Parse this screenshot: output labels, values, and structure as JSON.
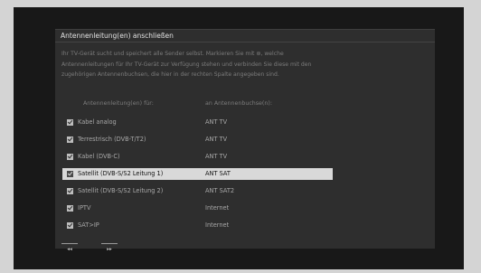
{
  "dialog": {
    "title": "Antennenleitung(en) anschließen",
    "description": [
      "Ihr TV-Gerät sucht und speichert alle Sender selbst. Markieren Sie mit ⊛, welche",
      "Antennenleitungen für Ihr TV-Gerät zur Verfügung stehen und verbinden Sie diese mit den",
      "zugehörigen Antennenbuchsen, die hier in der rechten Spalte angegeben sind."
    ]
  },
  "table": {
    "header_left": "Antennenleitung(en) für:",
    "header_right": "an Antennenbuchse(n):",
    "rows": [
      {
        "label": "Kabel analog",
        "value": "ANT TV",
        "checked": true,
        "selected": false
      },
      {
        "label": "Terrestrisch (DVB-T/T2)",
        "value": "ANT TV",
        "checked": true,
        "selected": false
      },
      {
        "label": "Kabel (DVB-C)",
        "value": "ANT TV",
        "checked": true,
        "selected": false
      },
      {
        "label": "Satellit (DVB-S/S2 Leitung 1)",
        "value": "ANT SAT",
        "checked": true,
        "selected": true
      },
      {
        "label": "Satellit (DVB-S/S2 Leitung 2)",
        "value": "ANT SAT2",
        "checked": true,
        "selected": false
      },
      {
        "label": "IPTV",
        "value": "Internet",
        "checked": true,
        "selected": false
      },
      {
        "label": "SAT>IP",
        "value": "Internet",
        "checked": true,
        "selected": false
      }
    ]
  },
  "nav": {
    "back_label": "◂◂",
    "forward_label": "▸▸"
  }
}
